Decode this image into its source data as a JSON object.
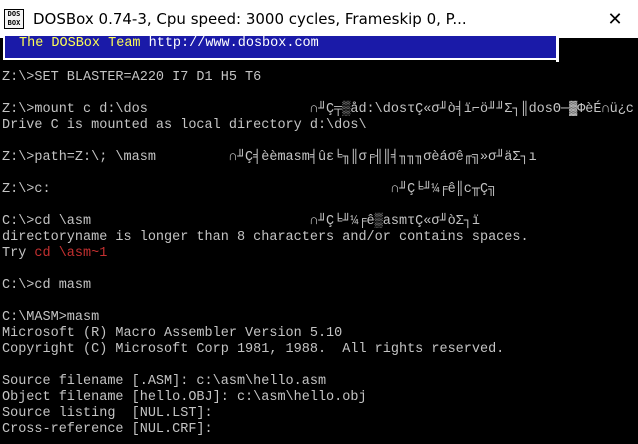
{
  "window": {
    "title": "DOSBox 0.74-3, Cpu speed:     3000 cycles, Frameskip  0, P...",
    "icon_text_top": "DOS",
    "icon_text_bottom": "BOX",
    "close_glyph": "✕"
  },
  "banner": {
    "team": "The DOSBox Team ",
    "url": "http://www.dosbox.com"
  },
  "console": {
    "lines": [
      "Z:\\>SET BLASTER=A220 I7 D1 H5 T6",
      "Z:\\>mount c d:\\dos                    ∩╜Ç╤▒åd:\\dosτÇ«σ╜ò╡ï⌐ö╜╜Σ┐║dosΘ─▓ΦèÉ∩ü¿c",
      "Drive C is mounted as local directory d:\\dos\\",
      "Z:\\>path=Z:\\; \\masm         ∩╜Ç╡èèmasm╡ûε╘╖║σ╒╢║╡╖╖╖σèáσê╓╗»σ╜äΣ┐ı",
      "Z:\\>c:                                          ∩╜Ç╘╜¼╒ê║c╥Ç╗",
      "C:\\>cd \\asm                           ∩╜Ç╘╜¼╒ê▒asmτÇ«σ╜òΣ┐ï",
      "directoryname is longer than 8 characters and/or contains spaces.",
      "Try ",
      "cd \\asm~1",
      "C:\\>cd masm",
      "C:\\MASM>masm",
      "Microsoft (R) Macro Assembler Version 5.10",
      "Copyright (C) Microsoft Corp 1981, 1988.  All rights reserved.",
      "Source filename [.ASM]: c:\\asm\\hello.asm",
      "Object filename [hello.OBJ]: c:\\asm\\hello.obj",
      "Source listing  [NUL.LST]:",
      "Cross-reference [NUL.CRF]:"
    ]
  },
  "colors": {
    "banner_bg": "#1a1aa8",
    "banner_text": "#ffff55",
    "console_text": "#c4c4c4",
    "error_hint": "#c43030"
  }
}
